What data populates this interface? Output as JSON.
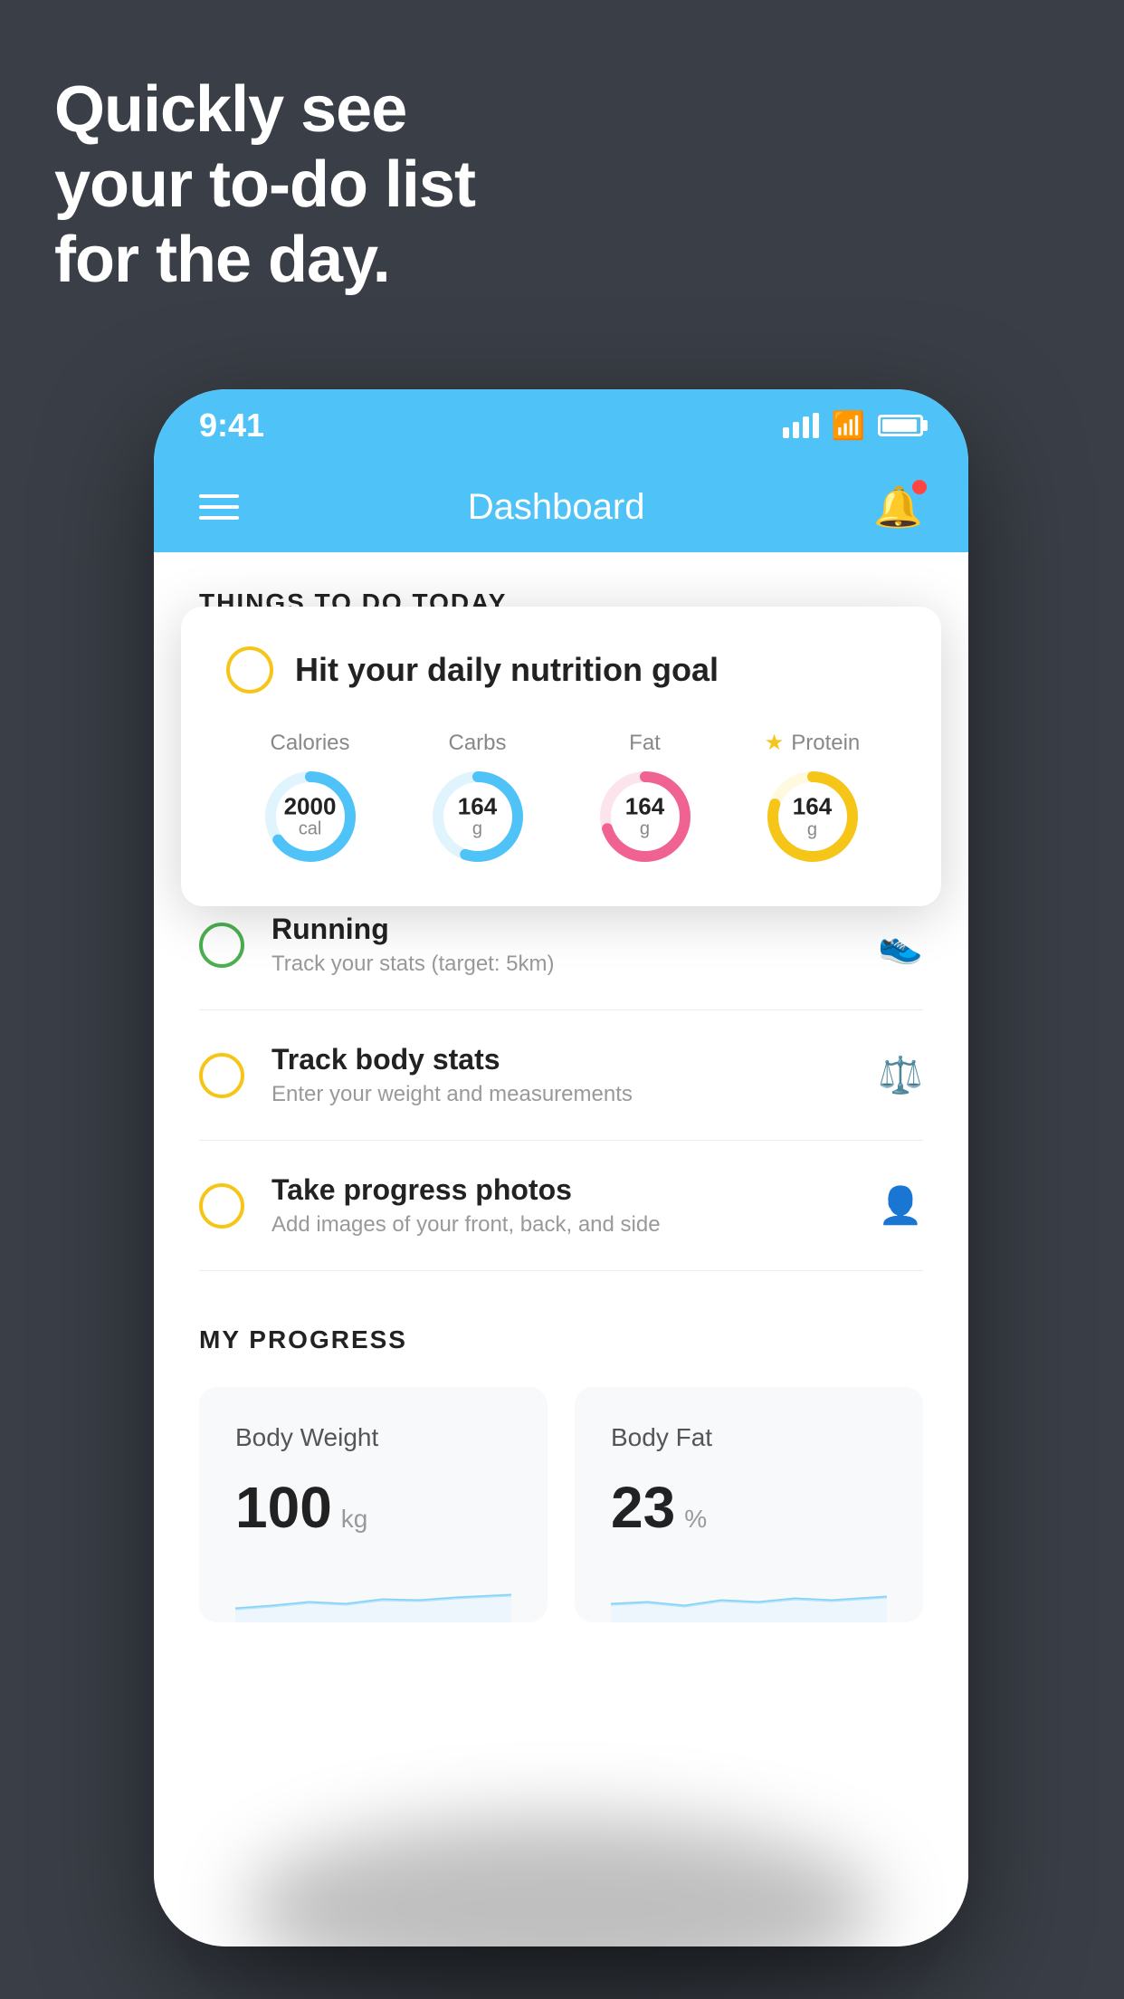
{
  "hero": {
    "line1": "Quickly see",
    "line2": "your to-do list",
    "line3": "for the day."
  },
  "statusBar": {
    "time": "9:41"
  },
  "header": {
    "title": "Dashboard"
  },
  "thingsToDo": {
    "sectionTitle": "THINGS TO DO TODAY",
    "nutritionCard": {
      "title": "Hit your daily nutrition goal",
      "macros": [
        {
          "label": "Calories",
          "value": "2000",
          "unit": "cal",
          "color": "#4fc3f7",
          "trackColor": "#e0f4fd",
          "percent": 65,
          "star": false
        },
        {
          "label": "Carbs",
          "value": "164",
          "unit": "g",
          "color": "#4fc3f7",
          "trackColor": "#e0f4fd",
          "percent": 55,
          "star": false
        },
        {
          "label": "Fat",
          "value": "164",
          "unit": "g",
          "color": "#f06292",
          "trackColor": "#fce4ec",
          "percent": 70,
          "star": false
        },
        {
          "label": "Protein",
          "value": "164",
          "unit": "g",
          "color": "#f5c518",
          "trackColor": "#fff9e0",
          "percent": 80,
          "star": true
        }
      ]
    },
    "items": [
      {
        "title": "Running",
        "subtitle": "Track your stats (target: 5km)",
        "circleColor": "green",
        "icon": "👟"
      },
      {
        "title": "Track body stats",
        "subtitle": "Enter your weight and measurements",
        "circleColor": "yellow",
        "icon": "⚖️"
      },
      {
        "title": "Take progress photos",
        "subtitle": "Add images of your front, back, and side",
        "circleColor": "yellow",
        "icon": "👤"
      }
    ]
  },
  "myProgress": {
    "sectionTitle": "MY PROGRESS",
    "cards": [
      {
        "title": "Body Weight",
        "value": "100",
        "unit": "kg"
      },
      {
        "title": "Body Fat",
        "value": "23",
        "unit": "%"
      }
    ]
  },
  "colors": {
    "headerBg": "#4fc3f7",
    "appBg": "#3a3f47",
    "cardBg": "#ffffff",
    "accent": "#f5c518"
  }
}
